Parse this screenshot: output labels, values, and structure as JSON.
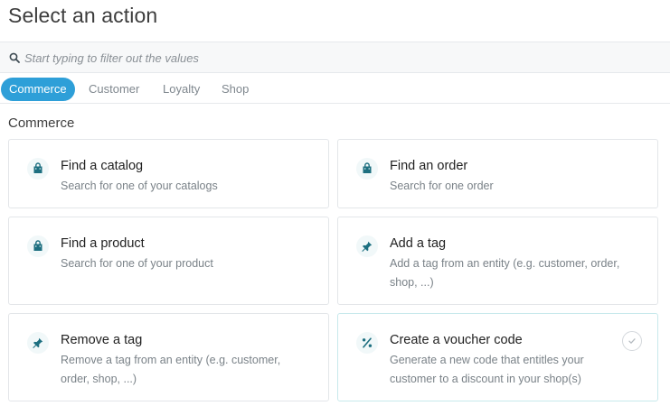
{
  "header": {
    "title": "Select an action"
  },
  "search": {
    "placeholder": "Start typing to filter out the values",
    "value": ""
  },
  "tabs": [
    {
      "label": "Commerce",
      "active": true
    },
    {
      "label": "Customer",
      "active": false
    },
    {
      "label": "Loyalty",
      "active": false
    },
    {
      "label": "Shop",
      "active": false
    }
  ],
  "section": {
    "title": "Commerce"
  },
  "actions": [
    {
      "icon": "shopping-bag-icon",
      "title": "Find a catalog",
      "description": "Search for one of your catalogs"
    },
    {
      "icon": "shopping-bag-icon",
      "title": "Find an order",
      "description": "Search for one order"
    },
    {
      "icon": "shopping-bag-icon",
      "title": "Find a product",
      "description": "Search for one of your product"
    },
    {
      "icon": "pin-icon",
      "title": "Add a tag",
      "description": "Add a tag from an entity (e.g. customer, order, shop, ...)"
    },
    {
      "icon": "pin-icon",
      "title": "Remove a tag",
      "description": "Remove a tag from an entity (e.g. customer, order, shop, ...)"
    },
    {
      "icon": "percent-icon",
      "title": "Create a voucher code",
      "description": "Generate a new code that entitles your customer to a discount in your shop(s)",
      "selected": true
    }
  ],
  "colors": {
    "accent": "#2e9fd8",
    "icon": "#1d6f80",
    "selected_border": "#c8e9ec"
  }
}
